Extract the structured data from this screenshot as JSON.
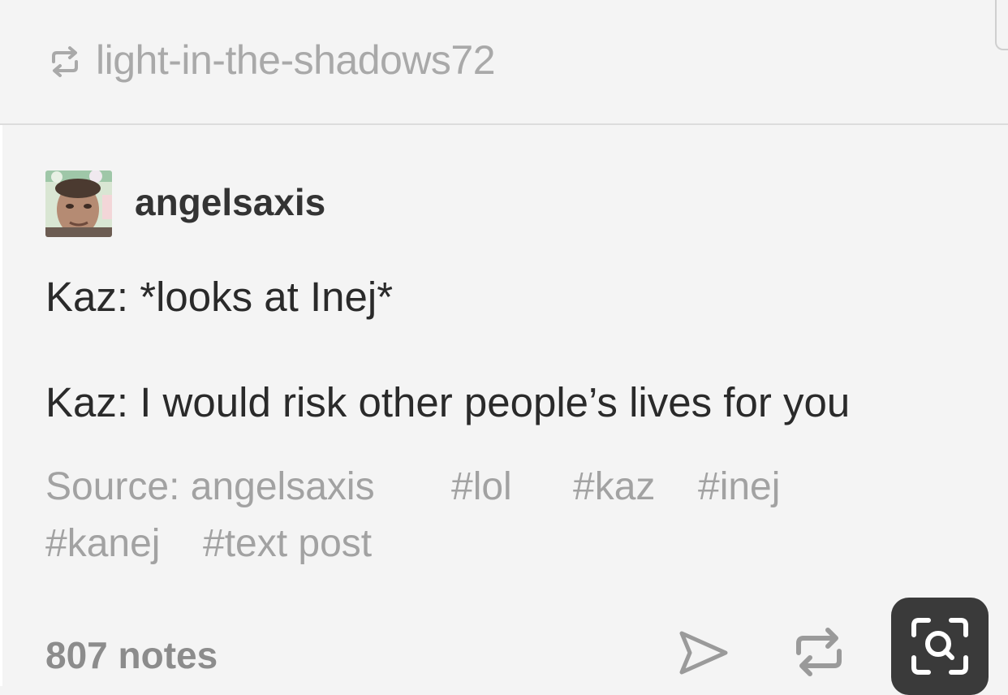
{
  "reblog": {
    "icon": "reblog-icon",
    "username": "light-in-the-shadows72"
  },
  "post": {
    "avatar": "avatar-image",
    "username": "angelsaxis",
    "lines": [
      "Kaz: *looks at Inej*",
      "Kaz: I would risk other people’s lives for you"
    ],
    "source": "Source: angelsaxis",
    "tags": [
      "#lol",
      "#kaz",
      "#inej",
      "#kanej",
      "#text post"
    ]
  },
  "footer": {
    "notes": "807 notes",
    "share_icon": "send-icon",
    "reblog_icon": "reblog-icon",
    "overlay_icon": "visual-search-icon"
  },
  "colors": {
    "background": "#f4f4f4",
    "text": "#2a2a2a",
    "muted": "#a2a2a2",
    "overlay": "#3a3a3a"
  }
}
